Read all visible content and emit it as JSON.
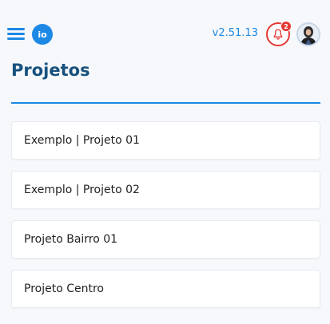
{
  "header": {
    "logo_text": "io",
    "version": "v2.51.13",
    "notification_count": "2",
    "accent_color": "#1e88e5",
    "alert_color": "#e53935"
  },
  "page": {
    "title": "Projetos"
  },
  "projects": [
    {
      "label": "Exemplo | Projeto 01"
    },
    {
      "label": "Exemplo | Projeto 02"
    },
    {
      "label": "Projeto Bairro 01"
    },
    {
      "label": "Projeto Centro"
    }
  ]
}
